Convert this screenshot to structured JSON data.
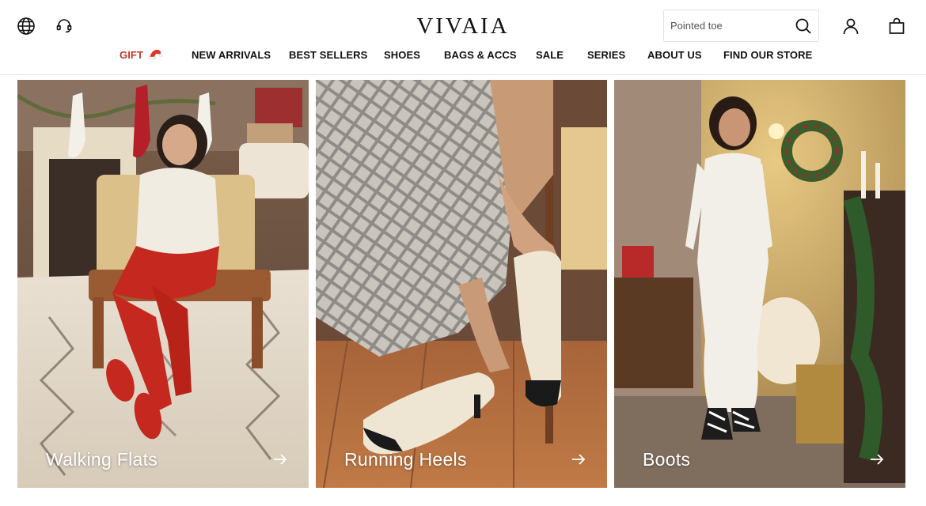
{
  "header": {
    "logo": "VIVAIA",
    "search": {
      "placeholder": "Pointed toe"
    },
    "icons": [
      "globe-icon",
      "headset-icon",
      "search-icon",
      "account-icon",
      "shopping-bag-icon"
    ]
  },
  "nav": {
    "items": [
      {
        "label": "GIFT"
      },
      {
        "label": "NEW ARRIVALS"
      },
      {
        "label": "BEST SELLERS"
      },
      {
        "label": "SHOES"
      },
      {
        "label": "BAGS & ACCS"
      },
      {
        "label": "SALE"
      },
      {
        "label": "SERIES"
      },
      {
        "label": "ABOUT US"
      },
      {
        "label": "FIND OUR STORE"
      }
    ]
  },
  "categories": [
    {
      "label": "Walking Flats"
    },
    {
      "label": "Running Heels"
    },
    {
      "label": "Boots"
    }
  ],
  "colors": {
    "gift_accent": "#c0392b",
    "text": "#111111",
    "divider": "#e6e6e6"
  }
}
